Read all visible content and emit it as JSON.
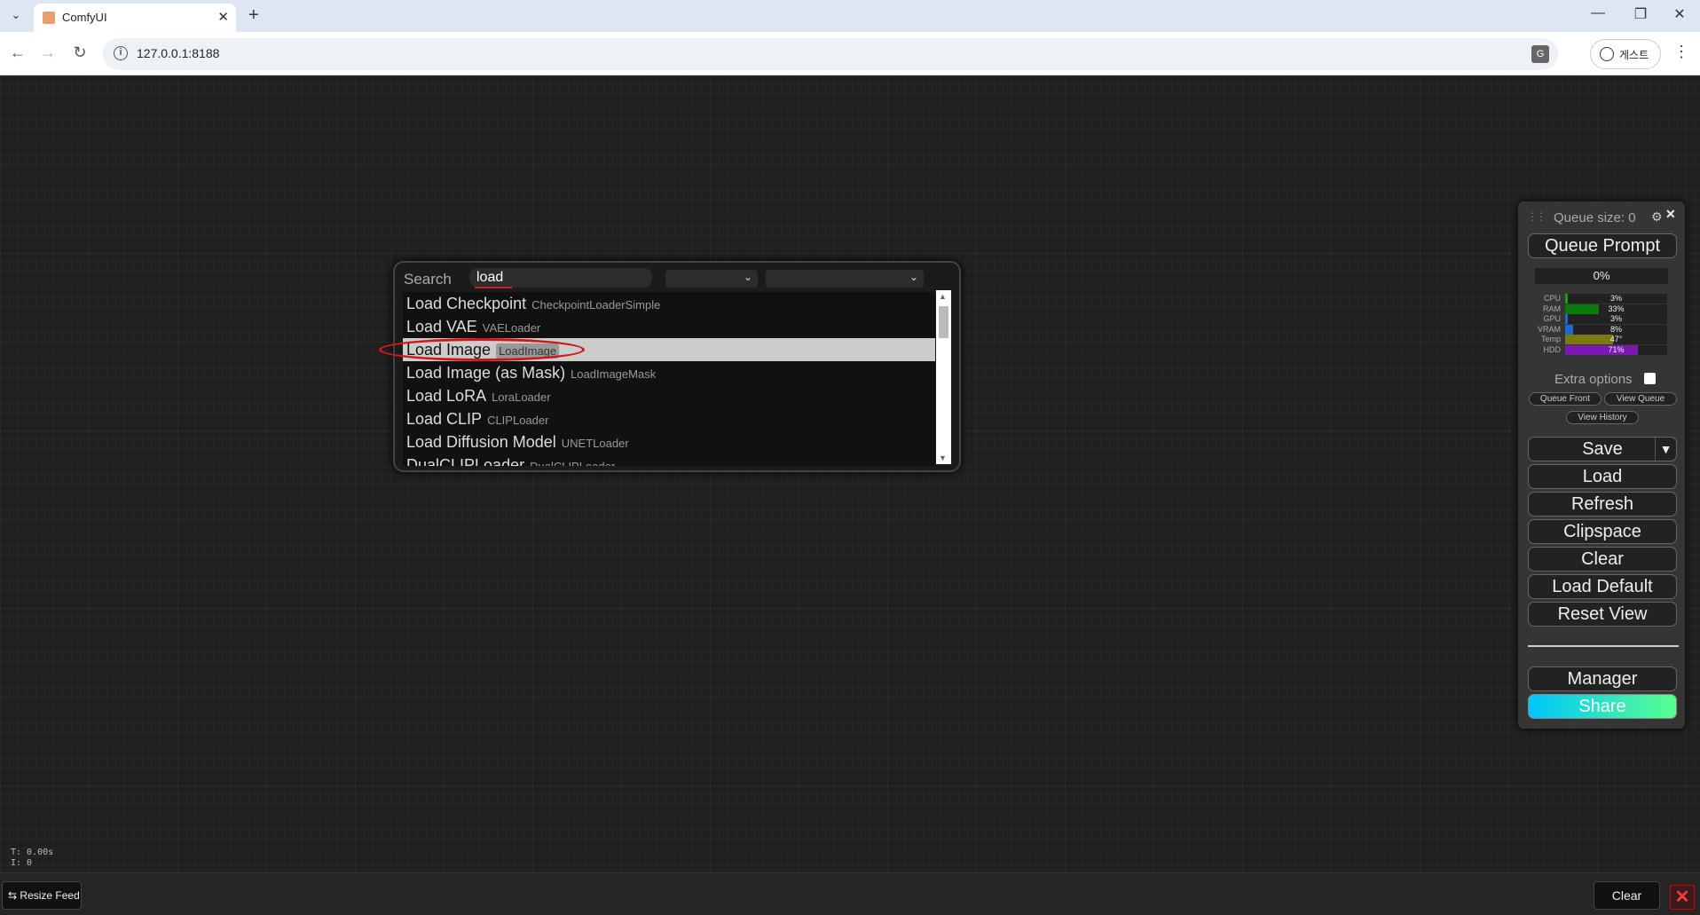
{
  "browser": {
    "tab_title": "ComfyUI",
    "url": "127.0.0.1:8188",
    "profile_label": "게스트",
    "new_tab_symbol": "+",
    "tab_close_symbol": "✕",
    "tab_list_symbol": "⌄",
    "back_symbol": "←",
    "forward_symbol": "→",
    "reload_symbol": "↻",
    "minimize_symbol": "—",
    "restore_symbol": "❐",
    "close_symbol": "✕",
    "menu_symbol": "⋮"
  },
  "search": {
    "label": "Search",
    "query": "load",
    "results": [
      {
        "name": "Load Checkpoint",
        "type": "CheckpointLoaderSimple"
      },
      {
        "name": "Load VAE",
        "type": "VAELoader"
      },
      {
        "name": "Load Image",
        "type": "LoadImage"
      },
      {
        "name": "Load Image (as Mask)",
        "type": "LoadImageMask"
      },
      {
        "name": "Load LoRA",
        "type": "LoraLoader"
      },
      {
        "name": "Load CLIP",
        "type": "CLIPLoader"
      },
      {
        "name": "Load Diffusion Model",
        "type": "UNETLoader"
      },
      {
        "name": "DualCLIPLoader",
        "type": "DualCLIPLoader"
      }
    ],
    "selected_index": 2,
    "highlight_color": "#d01818"
  },
  "menu": {
    "queue_size": "Queue size: 0",
    "queue_prompt": "Queue Prompt",
    "progress": "0%",
    "resources": [
      {
        "label": "CPU",
        "value": "3%",
        "pct": 3,
        "color": "#1a9a1a"
      },
      {
        "label": "RAM",
        "value": "33%",
        "pct": 33,
        "color": "#0a7a0a"
      },
      {
        "label": "GPU",
        "value": "3%",
        "pct": 3,
        "color": "#1a6ad0"
      },
      {
        "label": "VRAM",
        "value": "8%",
        "pct": 8,
        "color": "#1a6ad0"
      },
      {
        "label": "Temp",
        "value": "47°",
        "pct": 47,
        "color": "#7a7a10"
      },
      {
        "label": "HDD",
        "value": "71%",
        "pct": 71,
        "color": "#7a1ab0"
      }
    ],
    "extra_options": "Extra options",
    "queue_front": "Queue Front",
    "view_queue": "View Queue",
    "view_history": "View History",
    "save": "Save",
    "save_dropdown": "▼",
    "load": "Load",
    "refresh": "Refresh",
    "clipspace": "Clipspace",
    "clear": "Clear",
    "load_default": "Load Default",
    "reset_view": "Reset View",
    "manager": "Manager",
    "share": "Share"
  },
  "canvas_stats": {
    "time": "T: 0.00s",
    "i": "I: 0"
  },
  "feed": {
    "resize_label": "Resize Feed",
    "clear_label": "Clear",
    "close_symbol": "✕"
  }
}
